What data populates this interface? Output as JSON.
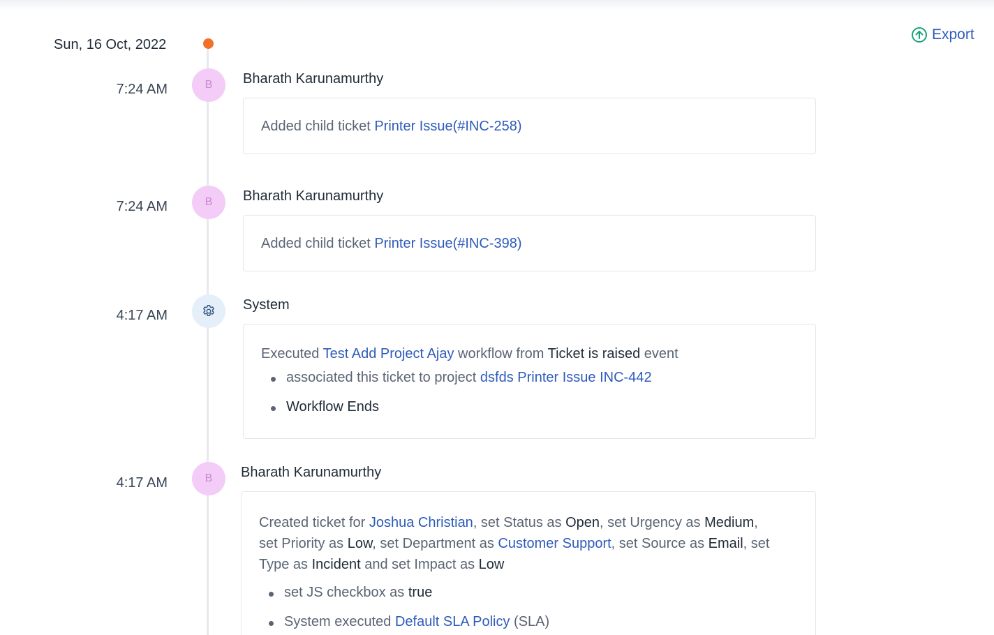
{
  "export_label": "Export",
  "date": "Sun, 16 Oct, 2022",
  "entries": [
    {
      "time": "7:24 AM",
      "avatar_letter": "B",
      "actor": "Bharath Karunamurthy",
      "text_prefix": "Added child ticket ",
      "link": "Printer Issue(#INC-258)"
    },
    {
      "time": "7:24 AM",
      "avatar_letter": "B",
      "actor": "Bharath Karunamurthy",
      "text_prefix": "Added child ticket ",
      "link": "Printer Issue(#INC-398)"
    },
    {
      "time": "4:17 AM",
      "avatar_icon": "gear-icon",
      "actor": "System",
      "line": {
        "t1": "Executed ",
        "workflow": "Test Add Project Ajay",
        "t2": " workflow from ",
        "event": "Ticket is raised",
        "t3": " event"
      },
      "bullets": [
        {
          "text": "associated this ticket to project ",
          "link": "dsfds Printer Issue INC-442"
        },
        {
          "text": "Workflow Ends"
        }
      ]
    },
    {
      "time": "4:17 AM",
      "avatar_letter": "B",
      "actor": "Bharath Karunamurthy",
      "created": {
        "t1": "Created ticket for ",
        "requester": "Joshua Christian",
        "t2": ", set Status as ",
        "status": "Open",
        "t3": ", set Urgency as ",
        "urgency": "Medium",
        "t4": ",",
        "t5": "set Priority as ",
        "priority": "Low",
        "t6": ", set Department as ",
        "department": "Customer Support",
        "t7": ", set Source as ",
        "source": "Email",
        "t8": ", set",
        "t9": "Type as ",
        "type": "Incident",
        "t10": " and set Impact as ",
        "impact": "Low"
      },
      "bullets": [
        {
          "text": "set JS checkbox as ",
          "value": "true"
        },
        {
          "text": "System executed ",
          "link": "Default SLA Policy",
          "suffix": " (SLA)"
        }
      ]
    }
  ],
  "colors": {
    "link": "#2e5bba",
    "date_dot": "#f07127",
    "avatar_bg": "#f3ccf7",
    "system_avatar_bg": "#e5effa",
    "export_icon": "#1aa37a"
  }
}
